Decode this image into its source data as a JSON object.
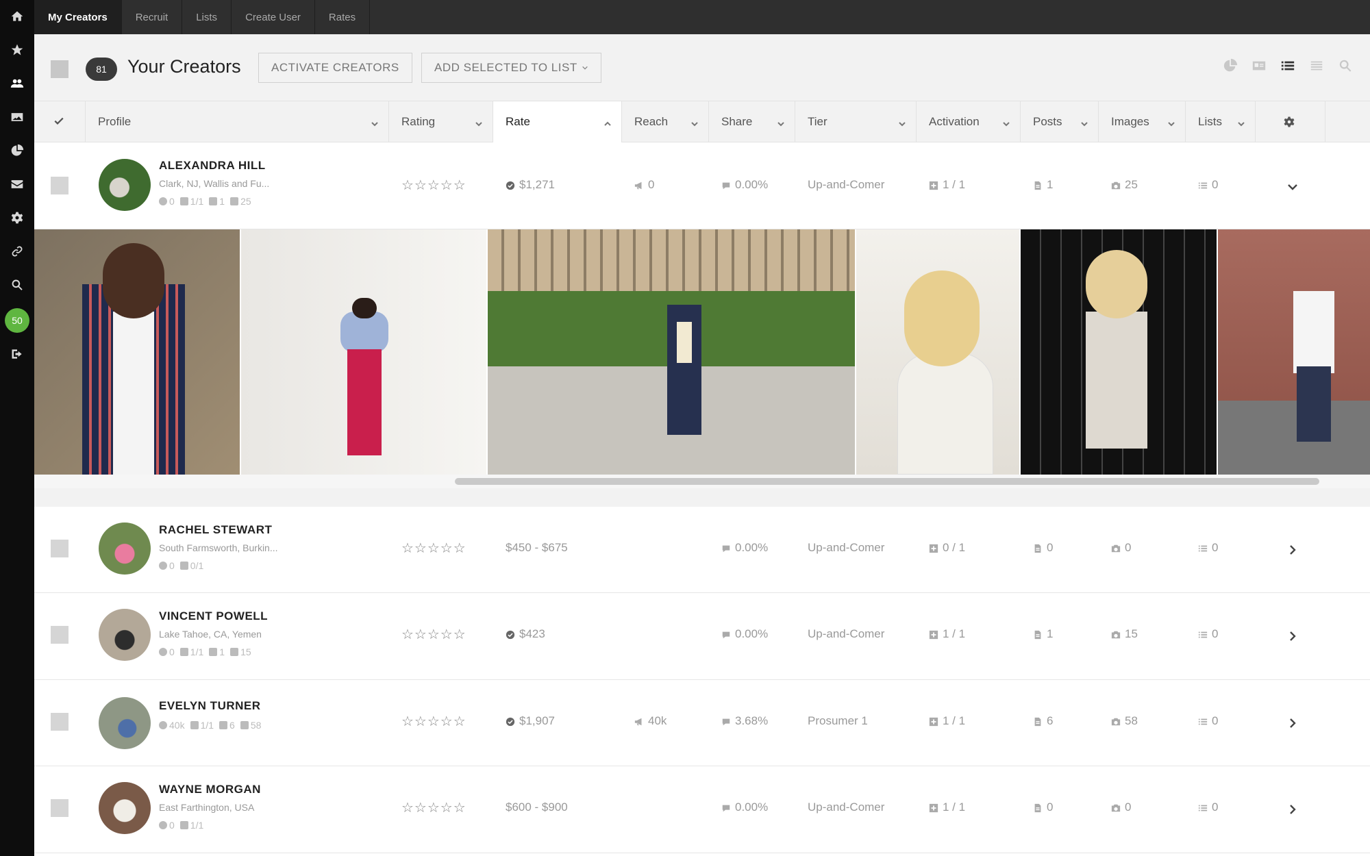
{
  "nav": {
    "tabs": [
      {
        "label": "My Creators",
        "active": true
      },
      {
        "label": "Recruit",
        "active": false
      },
      {
        "label": "Lists",
        "active": false
      },
      {
        "label": "Create User",
        "active": false
      },
      {
        "label": "Rates",
        "active": false
      }
    ]
  },
  "sidebar": {
    "icons": [
      "home-icon",
      "star-icon",
      "users-icon",
      "image-icon",
      "pie-chart-icon",
      "envelope-icon",
      "gear-icon",
      "link-icon",
      "search-icon",
      "badge",
      "sign-out-icon"
    ],
    "badge": "50",
    "active_icon": "users-icon"
  },
  "header": {
    "count": "81",
    "title": "Your Creators",
    "activate_label": "ACTIVATE CREATORS",
    "add_to_list_label": "ADD SELECTED TO LIST",
    "view_icons": [
      "pie-chart-icon",
      "card-view-icon",
      "list-view-icon",
      "compact-list-icon",
      "search-icon"
    ],
    "active_view": "list-view-icon"
  },
  "columns": {
    "profile": "Profile",
    "rating": "Rating",
    "rate": "Rate",
    "reach": "Reach",
    "share": "Share",
    "tier": "Tier",
    "activation": "Activation",
    "posts": "Posts",
    "images": "Images",
    "lists": "Lists",
    "sorted_column": "Rate"
  },
  "creators": [
    {
      "name": "ALEXANDRA HILL",
      "location": "Clark, NJ, Wallis and Fu...",
      "mini_reach": "0",
      "mini_activation": "1/1",
      "mini_posts": "1",
      "mini_images": "25",
      "rating": "☆☆☆☆☆",
      "rate": "$1,271",
      "rate_verified": true,
      "reach": "0",
      "share": "0.00%",
      "tier": "Up-and-Comer",
      "activation": "1 / 1",
      "posts": "1",
      "images": "25",
      "lists": "0",
      "expanded": true
    },
    {
      "name": "RACHEL STEWART",
      "location": "South Farmsworth, Burkin...",
      "mini_reach": "0",
      "mini_activation": "0/1",
      "rating": "☆☆☆☆☆",
      "rate": "$450 - $675",
      "rate_verified": false,
      "share": "0.00%",
      "tier": "Up-and-Comer",
      "activation": "0 / 1",
      "posts": "0",
      "images": "0",
      "lists": "0",
      "expanded": false
    },
    {
      "name": "VINCENT POWELL",
      "location": "Lake Tahoe, CA, Yemen",
      "mini_reach": "0",
      "mini_activation": "1/1",
      "mini_posts": "1",
      "mini_images": "15",
      "rating": "☆☆☆☆☆",
      "rate": "$423",
      "rate_verified": true,
      "share": "0.00%",
      "tier": "Up-and-Comer",
      "activation": "1 / 1",
      "posts": "1",
      "images": "15",
      "lists": "0",
      "expanded": false
    },
    {
      "name": "EVELYN TURNER",
      "location": "",
      "mini_reach": "40k",
      "mini_activation": "1/1",
      "mini_posts": "6",
      "mini_images": "58",
      "rating": "☆☆☆☆☆",
      "rate": "$1,907",
      "rate_verified": true,
      "reach": "40k",
      "share": "3.68%",
      "tier": "Prosumer 1",
      "activation": "1 / 1",
      "posts": "6",
      "images": "58",
      "lists": "0",
      "expanded": false
    },
    {
      "name": "WAYNE MORGAN",
      "location": "East Farthington, USA",
      "mini_reach": "0",
      "mini_activation": "1/1",
      "rating": "☆☆☆☆☆",
      "rate": "$600 - $900",
      "rate_verified": false,
      "share": "0.00%",
      "tier": "Up-and-Comer",
      "activation": "1 / 1",
      "posts": "0",
      "images": "0",
      "lists": "0",
      "expanded": false
    }
  ],
  "gallery": {
    "photos": [
      {
        "bg": "#8a7a62",
        "accent": "#1f2a4d"
      },
      {
        "bg": "#e8e6e2",
        "accent": "#c91f4c"
      },
      {
        "bg": "#6f8a4f",
        "accent": "#26304f"
      },
      {
        "bg": "#f4f2ee",
        "accent": "#f2ead2"
      },
      {
        "bg": "#1a1a1a",
        "accent": "#e6e2da"
      },
      {
        "bg": "#a06a5e",
        "accent": "#f2f2f2"
      }
    ]
  }
}
